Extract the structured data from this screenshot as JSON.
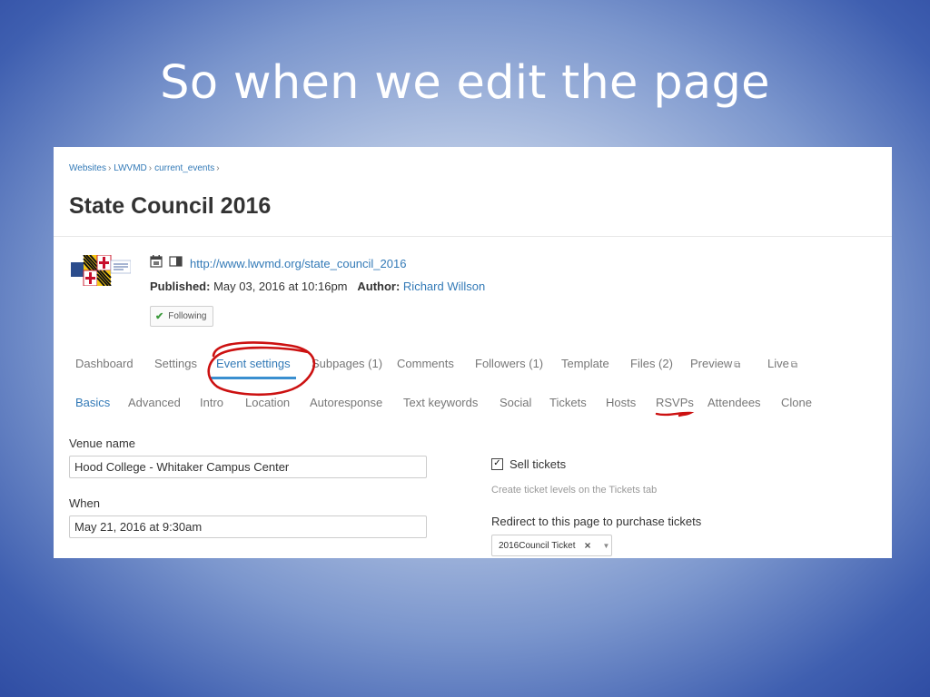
{
  "slide": {
    "title": "So when we edit the page"
  },
  "breadcrumb": [
    "Websites",
    "LWVMD",
    "current_events"
  ],
  "breadcrumb_sep": "›",
  "page": {
    "title": "State Council 2016",
    "url": "http://www.lwvmd.org/state_council_2016",
    "published_label": "Published:",
    "published_value": "May 03, 2016 at 10:16pm",
    "author_label": "Author:",
    "author_value": "Richard Willson",
    "follow_label": "Following"
  },
  "main_tabs": [
    {
      "label": "Dashboard"
    },
    {
      "label": "Settings"
    },
    {
      "label": "Event settings",
      "active": true
    },
    {
      "label": "Subpages (1)"
    },
    {
      "label": "Comments"
    },
    {
      "label": "Followers (1)"
    },
    {
      "label": "Template"
    },
    {
      "label": "Files (2)"
    },
    {
      "label": "Preview"
    },
    {
      "label": "Live"
    }
  ],
  "sub_tabs": [
    {
      "label": "Basics",
      "active": true
    },
    {
      "label": "Advanced"
    },
    {
      "label": "Intro"
    },
    {
      "label": "Location"
    },
    {
      "label": "Autoresponse"
    },
    {
      "label": "Text keywords"
    },
    {
      "label": "Social"
    },
    {
      "label": "Tickets"
    },
    {
      "label": "Hosts"
    },
    {
      "label": "RSVPs"
    },
    {
      "label": "Attendees"
    },
    {
      "label": "Clone"
    }
  ],
  "form": {
    "venue_label": "Venue name",
    "venue_value": "Hood College - Whitaker Campus Center",
    "when_label": "When",
    "when_value": "May 21, 2016 at 9:30am",
    "sell_tickets_label": "Sell tickets",
    "sell_tickets_checked": true,
    "sell_tickets_help": "Create ticket levels on the Tickets tab",
    "redirect_label": "Redirect to this page to purchase tickets",
    "redirect_value": "2016Council Ticket"
  },
  "colors": {
    "link": "#337ab7",
    "tab_underline": "#3a8fd0",
    "annotation": "#cc1111",
    "check_green": "#3c9a3c"
  },
  "icons": [
    "calendar-icon",
    "page-icon",
    "check-icon",
    "external-link-icon",
    "clear-x-icon",
    "caret-down-icon"
  ]
}
